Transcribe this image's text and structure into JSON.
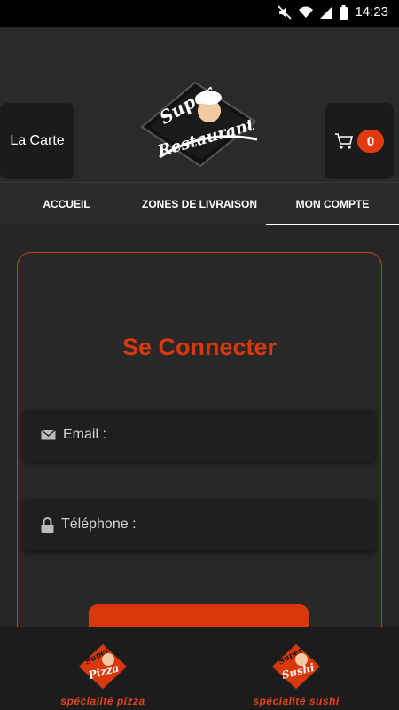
{
  "status_bar": {
    "time": "14:23"
  },
  "header": {
    "carte_label": "La Carte",
    "logo_top": "Super",
    "logo_bottom": "Restaurant",
    "cart_count": "0"
  },
  "tabs": [
    {
      "label": "ACCUEIL"
    },
    {
      "label": "ZONES DE LIVRAISON"
    },
    {
      "label": "MON COMPTE",
      "active": true
    }
  ],
  "login": {
    "title": "Se Connecter",
    "email_placeholder": "Email :",
    "phone_placeholder": "Téléphone :"
  },
  "bottom_nav": {
    "pizza": {
      "logo_top": "Super",
      "logo_word": "Pizza",
      "label": "spécialité pizza"
    },
    "sushi": {
      "logo_top": "Super",
      "logo_word": "Sushi",
      "label": "spécialité sushi"
    }
  },
  "colors": {
    "accent": "#d8380c",
    "background": "#232323"
  }
}
